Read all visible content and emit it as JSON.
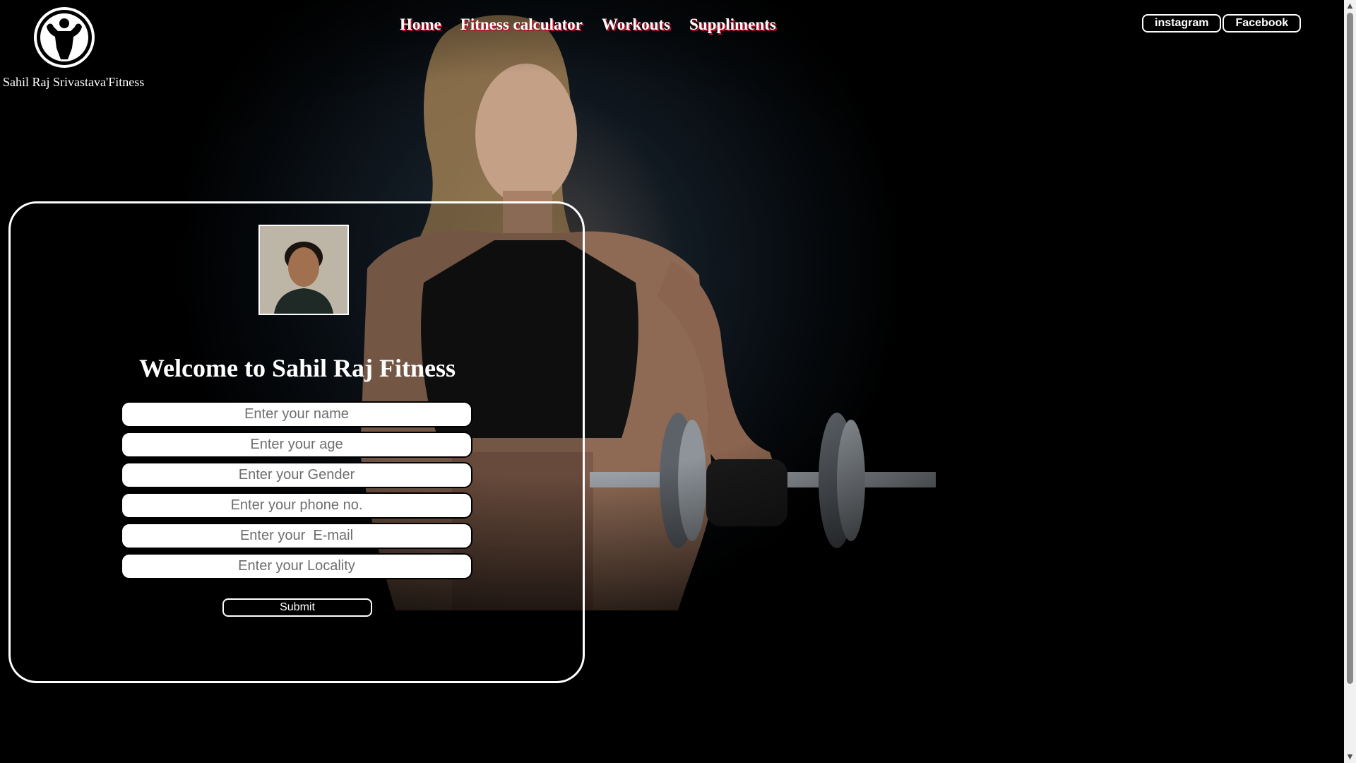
{
  "brand": {
    "name": "Sahil Raj Srivastava'Fitness"
  },
  "nav": {
    "items": [
      {
        "label": "Home"
      },
      {
        "label": "Fitness calculator"
      },
      {
        "label": "Workouts"
      },
      {
        "label": "Suppliments"
      }
    ]
  },
  "social": {
    "instagram_label": "instagram",
    "facebook_label": "Facebook"
  },
  "form": {
    "title": "Welcome to Sahil Raj Fitness",
    "fields": [
      {
        "placeholder": "Enter your name",
        "value": ""
      },
      {
        "placeholder": "Enter your age",
        "value": ""
      },
      {
        "placeholder": "Enter your Gender",
        "value": ""
      },
      {
        "placeholder": "Enter your phone no.",
        "value": ""
      },
      {
        "placeholder": "Enter your  E-mail",
        "value": ""
      },
      {
        "placeholder": "Enter your Locality",
        "value": ""
      }
    ],
    "submit_label": "Submit"
  },
  "icons": {
    "logo": "bodybuilder-logo-icon",
    "avatar": "profile-photo",
    "scroll_up": "scroll-up-arrow-icon",
    "scroll_down": "scroll-down-arrow-icon"
  },
  "colors": {
    "background": "#000000",
    "nav_text": "#ffffff",
    "nav_text_shadow": "#c0102a",
    "card_border": "#ffffff",
    "input_background": "#ffffff"
  }
}
